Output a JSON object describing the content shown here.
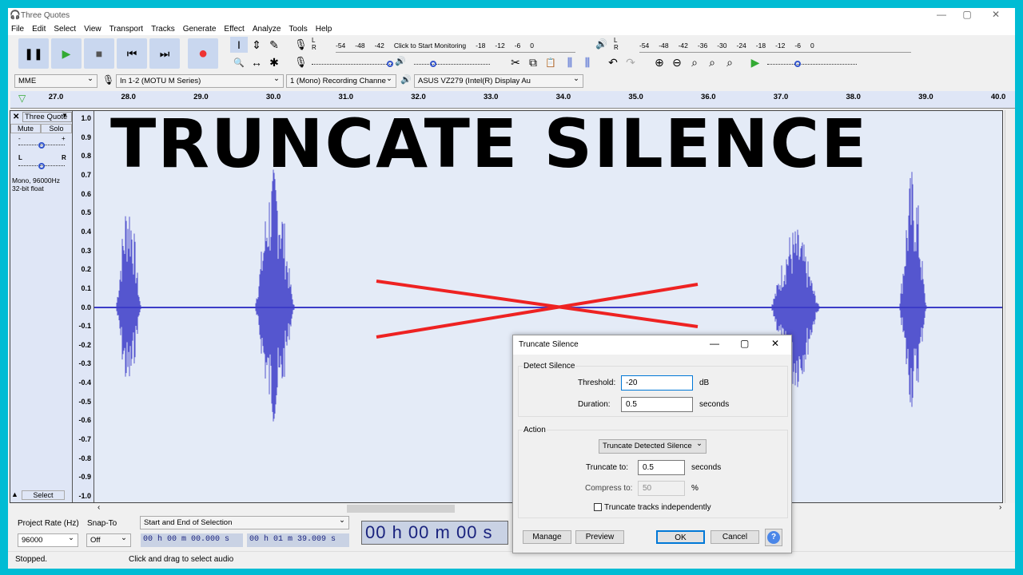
{
  "window": {
    "title": "Three Quotes",
    "controls": [
      "—",
      "▢",
      "✕"
    ]
  },
  "menu": [
    "File",
    "Edit",
    "Select",
    "View",
    "Transport",
    "Tracks",
    "Generate",
    "Effect",
    "Analyze",
    "Tools",
    "Help"
  ],
  "transport": {
    "pause": "❚❚",
    "play": "▶",
    "stop": "■",
    "skip_start": "⏮",
    "skip_end": "⏭",
    "record": "●"
  },
  "tools": [
    "I",
    "⇕",
    "✎",
    "🔍",
    "↔",
    "✱"
  ],
  "meters": {
    "record_ticks": [
      "-54",
      "-48",
      "-42",
      "Click to Start Monitoring",
      "-18",
      "-12",
      "-6",
      "0"
    ],
    "playback_ticks": [
      "-54",
      "-48",
      "-42",
      "-36",
      "-30",
      "-24",
      "-18",
      "-12",
      "-6",
      "0"
    ],
    "lr": [
      "L",
      "R"
    ]
  },
  "edit_tools": [
    "✂",
    "⧉",
    "📋",
    "⫼",
    "⫼",
    "↶",
    "↷",
    "⊕",
    "⊖",
    "⌕",
    "⌕",
    "⌕",
    "▶"
  ],
  "devices": {
    "host": "MME",
    "input": "In 1-2 (MOTU M Series)",
    "channels": "1 (Mono) Recording Channe",
    "output": "ASUS VZ279 (Intel(R) Display Au"
  },
  "ruler": {
    "ticks": [
      "27.0",
      "28.0",
      "29.0",
      "30.0",
      "31.0",
      "32.0",
      "33.0",
      "34.0",
      "35.0",
      "36.0",
      "37.0",
      "38.0",
      "39.0",
      "40.0"
    ]
  },
  "track": {
    "name": "Three Quote",
    "mute": "Mute",
    "solo": "Solo",
    "gain_minus": "-",
    "gain_plus": "+",
    "pan_l": "L",
    "pan_r": "R",
    "info1": "Mono, 96000Hz",
    "info2": "32-bit float",
    "select": "Select",
    "gain": 0.5,
    "pan": 0.5
  },
  "vruler": [
    "1.0",
    "0.9",
    "0.8",
    "0.7",
    "0.6",
    "0.5",
    "0.4",
    "0.3",
    "0.2",
    "0.1",
    "0.0",
    "-0.1",
    "-0.2",
    "-0.3",
    "-0.4",
    "-0.5",
    "-0.6",
    "-0.7",
    "-0.8",
    "-0.9",
    "-1.0"
  ],
  "overlay": {
    "title": "TRUNCATE SILENCE",
    "colors": {
      "waveform": "#3c3cc8",
      "cross": "#ee2222"
    }
  },
  "dialog": {
    "title": "Truncate Silence",
    "detect_label": "Detect Silence",
    "threshold_label": "Threshold:",
    "threshold": "-20",
    "threshold_unit": "dB",
    "duration_label": "Duration:",
    "duration": "0.5",
    "duration_unit": "seconds",
    "action_label": "Action",
    "action": "Truncate Detected Silence",
    "truncate_label": "Truncate to:",
    "truncate": "0.5",
    "truncate_unit": "seconds",
    "compress_label": "Compress to:",
    "compress": "50",
    "compress_unit": "%",
    "independent_label": "Truncate tracks independently",
    "independent": false,
    "manage": "Manage",
    "preview": "Preview",
    "ok": "OK",
    "cancel": "Cancel",
    "help": "?"
  },
  "selection": {
    "rate_label": "Project Rate (Hz)",
    "snap_label": "Snap-To",
    "rate": "96000",
    "snap": "Off",
    "mode": "Start and End of Selection",
    "start": "00 h 00 m 00.000 s",
    "end": "00 h 01 m 39.009 s",
    "time": "00 h 00 m 00 s"
  },
  "status": {
    "state": "Stopped.",
    "hint": "Click and drag to select audio"
  }
}
